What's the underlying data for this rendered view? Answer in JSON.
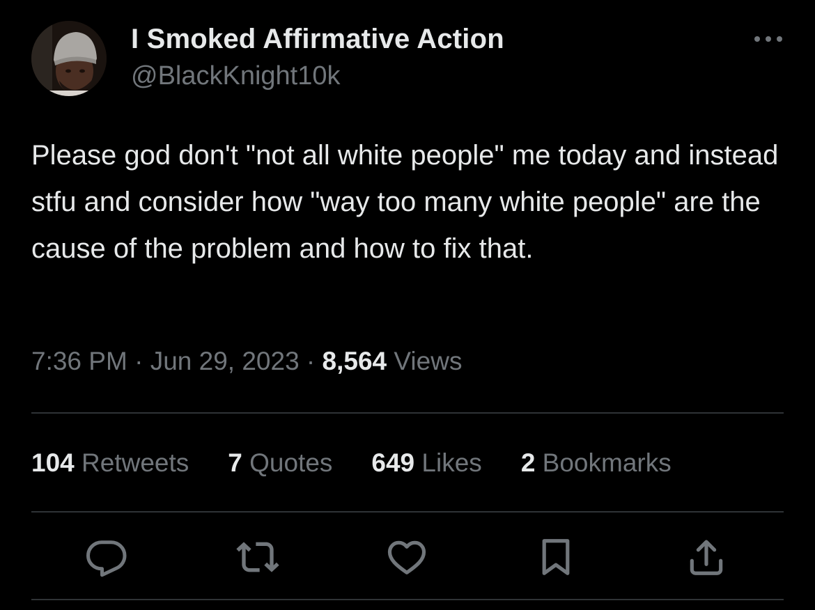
{
  "author": {
    "display_name": "I Smoked Affirmative Action",
    "handle": "@BlackKnight10k",
    "avatar_icon": "profile-photo"
  },
  "tweet": {
    "text": "Please god don't \"not all white people\" me today and instead stfu and consider how \"way too many white people\" are the cause of the problem and how to fix that.",
    "time": "7:36 PM",
    "date": "Jun 29, 2023",
    "views_count": "8,564",
    "views_label": "Views",
    "separator": " · "
  },
  "stats": {
    "retweets_count": "104",
    "retweets_label": "Retweets",
    "quotes_count": "7",
    "quotes_label": "Quotes",
    "likes_count": "649",
    "likes_label": "Likes",
    "bookmarks_count": "2",
    "bookmarks_label": "Bookmarks"
  },
  "actions": {
    "reply_icon": "reply-icon",
    "retweet_icon": "retweet-icon",
    "like_icon": "heart-icon",
    "bookmark_icon": "bookmark-icon",
    "share_icon": "share-icon",
    "more_icon": "more-icon"
  },
  "colors": {
    "background": "#000000",
    "text_primary": "#e7e9ea",
    "text_secondary": "#71767b",
    "divider": "#2f3336"
  }
}
